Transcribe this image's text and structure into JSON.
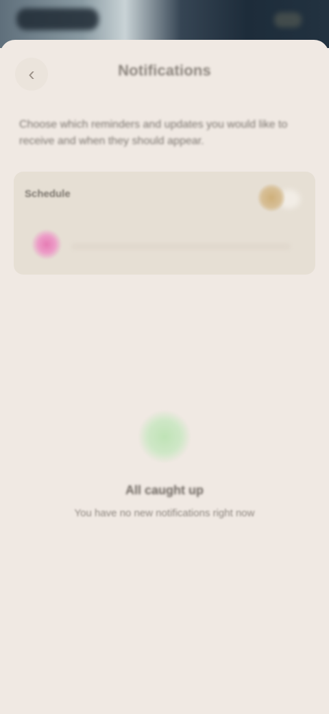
{
  "header": {
    "back_icon": "chevron-left-icon",
    "back_glyph": "‹",
    "title": "Notifications"
  },
  "intro": {
    "text": "Choose which reminders and updates you would like to receive and when they should appear."
  },
  "card": {
    "title": "Schedule",
    "sun_icon": "sun-icon",
    "flower_icon": "flower-icon"
  },
  "empty_state": {
    "icon": "check-circle-icon",
    "title": "All caught up",
    "subtitle": "You have no new notifications right now"
  },
  "colors": {
    "background": "#f0e9e3",
    "card": "#e6dfd4",
    "accent_green": "#bfe3b6",
    "accent_pink": "#e67cb4",
    "accent_gold": "#cfb07a"
  }
}
